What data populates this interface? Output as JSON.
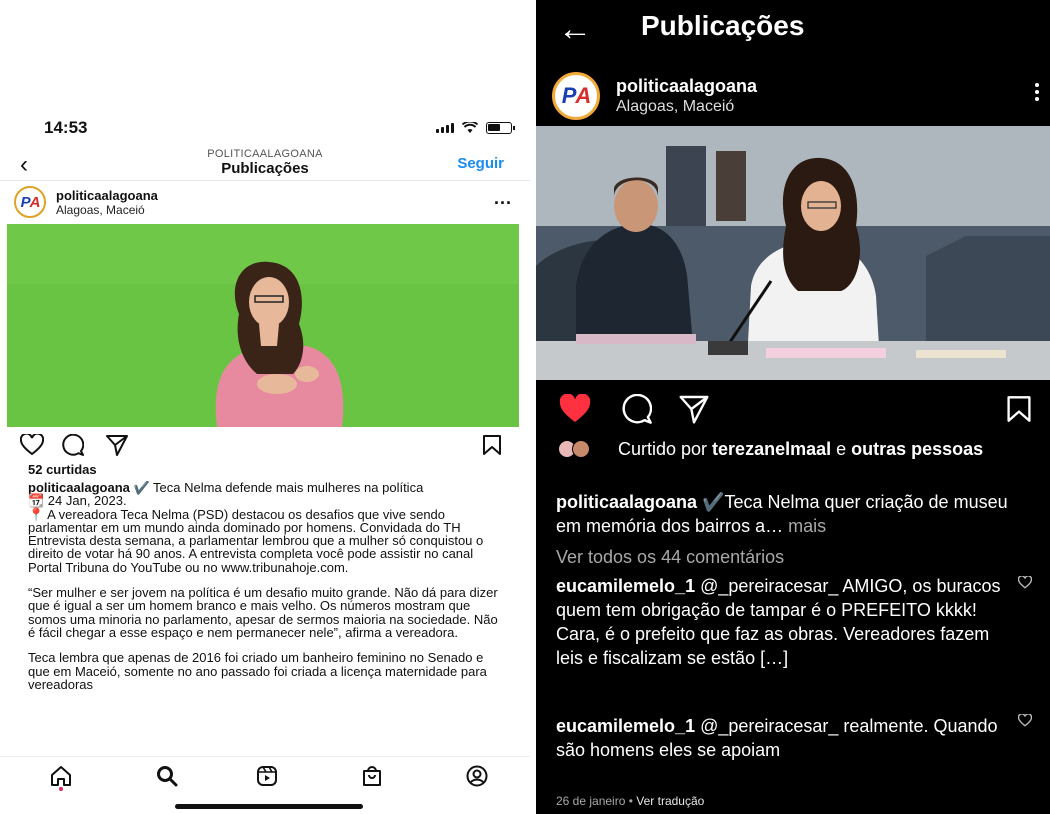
{
  "left": {
    "status": {
      "time": "14:53"
    },
    "nav": {
      "back_icon": "‹",
      "account": "POLITICAALAGOANA",
      "title": "Publicações",
      "follow": "Seguir"
    },
    "post": {
      "username": "politicaalagoana",
      "location": "Alagoas, Maceió",
      "more": "...",
      "likes": "52 curtidas",
      "caption_user": "politicaalagoana",
      "caption_title": " ✔️ Teca Nelma defende mais mulheres na política",
      "caption_date": "📆 24 Jan, 2023.",
      "caption_p1": "📍 A vereadora Teca Nelma (PSD) destacou os desafios que vive sendo parlamentar em um mundo ainda dominado por homens. Convidada do TH Entrevista desta semana, a parlamentar lembrou que a mulher só conquistou o direito de votar há 90 anos. A entrevista completa você pode assistir no canal Portal Tribuna do YouTube ou no www.tribunahoje.com.",
      "caption_p2": "“Ser mulher e ser jovem na política é um desafio muito grande. Não dá para dizer que é igual a ser um homem branco e mais velho. Os números mostram que somos uma minoria no parlamento, apesar de sermos maioria na sociedade. Não é fácil chegar a esse espaço e nem permanecer nele”, afirma a vereadora.",
      "caption_p3": "Teca lembra que apenas de 2016 foi criado um banheiro feminino no Senado e que em Maceió, somente no ano passado foi criada a licença maternidade para vereadoras"
    },
    "tabs": [
      "home-icon",
      "search-icon",
      "reels-icon",
      "shop-icon",
      "profile-icon"
    ]
  },
  "right": {
    "back_icon": "←",
    "title": "Publicações",
    "post": {
      "username": "politicaalagoana",
      "location": "Alagoas, Maceió",
      "liked_prefix": "Curtido por ",
      "liked_user": "terezanelmaal",
      "liked_mid": " e ",
      "liked_others": "outras pessoas",
      "caption_user": "politicaalagoana",
      "caption_text": " ✔️Teca Nelma quer criação de museu em memória dos bairros a…",
      "caption_more": " mais",
      "view_all": "Ver todos os 44 comentários",
      "comments": [
        {
          "user": "eucamilemelo_1",
          "text": " @_pereiracesar_ AMIGO, os buracos quem tem obrigação de tampar é o PREFEITO kkkk! Cara, é o prefeito que faz as obras. Vereadores fazem leis e fiscalizam se estão […]"
        },
        {
          "user": "eucamilemelo_1",
          "text": " @_pereiracesar_ realmente. Quando são homens eles se apoiam"
        }
      ],
      "date": "26 de janeiro",
      "date_sep": " • ",
      "translate": "Ver tradução"
    },
    "colors": {
      "like_red": "#ff3040",
      "muted": "#a8a8a8"
    }
  }
}
